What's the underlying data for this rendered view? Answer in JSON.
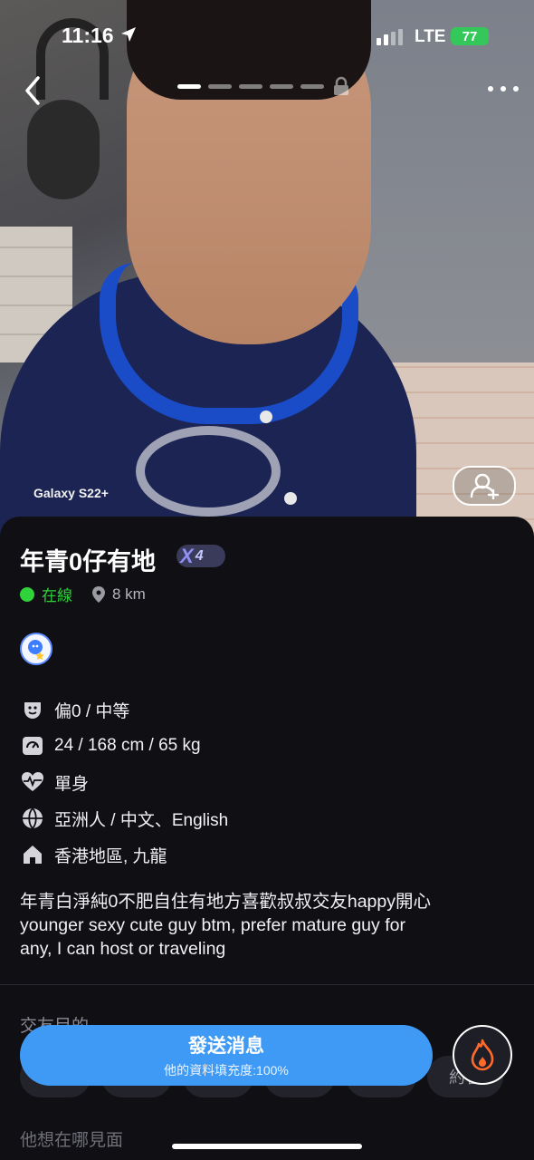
{
  "status_bar": {
    "time": "11:16",
    "network": "LTE",
    "battery": "77"
  },
  "photo": {
    "camera_watermark": "Galaxy S22+",
    "segments_total": 5,
    "segments_active": 1
  },
  "profile": {
    "name": "年青0仔有地",
    "level": "4",
    "status": "在線",
    "distance": "8 km",
    "role": "偏0 / 中等",
    "stats": "24 / 168 cm / 65 kg",
    "relationship": "單身",
    "ethnicity_language": "亞洲人 / 中文、English",
    "location": "香港地區, 九龍",
    "bio_line1": "年青白淨純0不肥自住有地方喜歡叔叔交友happy開心",
    "bio_line2": "younger sexy cute guy btm, prefer mature guy for",
    "bio_line3": "any, I can host or traveling"
  },
  "sections": {
    "purpose_title": "交友目的",
    "meet_title": "他想在哪見面"
  },
  "chips": [
    "",
    "",
    "",
    "",
    "",
    "約會"
  ],
  "actions": {
    "send_label": "發送消息",
    "profile_completion": "他的資料填充度:100%"
  },
  "colors": {
    "accent": "#3e9af5",
    "online": "#2fd23a",
    "fire": "#ff6a2b"
  },
  "icons": [
    "back-icon",
    "more-icon",
    "lock-icon",
    "add-friend-icon",
    "location-pin-icon",
    "badge-icon",
    "role-icon",
    "scale-icon",
    "heart-pulse-icon",
    "globe-icon",
    "home-icon",
    "fire-icon"
  ]
}
